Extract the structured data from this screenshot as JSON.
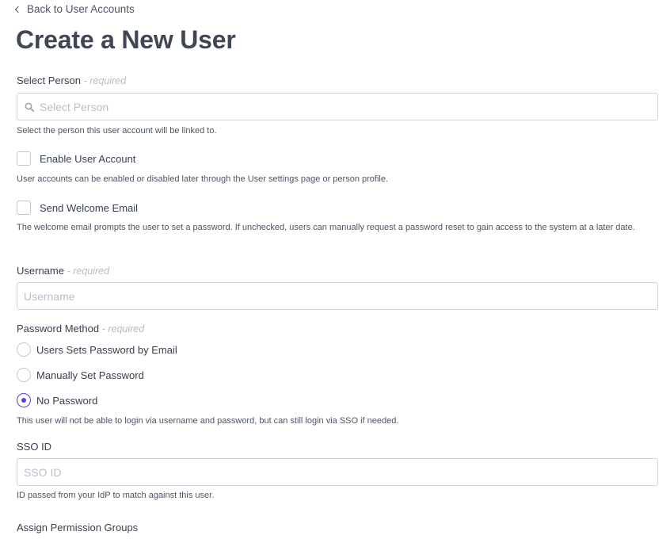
{
  "nav": {
    "back_label": "Back to User Accounts"
  },
  "page": {
    "title": "Create a New User"
  },
  "person": {
    "label": "Select Person",
    "required": "- required",
    "placeholder": "Select Person",
    "help": "Select the person this user account will be linked to."
  },
  "enable_account": {
    "label": "Enable User Account",
    "checked": false,
    "help": "User accounts can be enabled or disabled later through the User settings page or person profile."
  },
  "welcome_email": {
    "label": "Send Welcome Email",
    "checked": false,
    "help": "The welcome email prompts the user to set a password. If unchecked, users can manually request a password reset to gain access to the system at a later date."
  },
  "username": {
    "label": "Username",
    "required": "- required",
    "placeholder": "Username"
  },
  "password_method": {
    "label": "Password Method",
    "required": "- required",
    "options": [
      {
        "label": "Users Sets Password by Email",
        "selected": false
      },
      {
        "label": "Manually Set Password",
        "selected": false
      },
      {
        "label": "No Password",
        "selected": true
      }
    ],
    "help": "This user will not be able to login via username and password, but can still login via SSO if needed."
  },
  "sso": {
    "label": "SSO ID",
    "placeholder": "SSO ID",
    "help": "ID passed from your IdP to match against this user."
  },
  "permission_groups": {
    "label": "Assign Permission Groups"
  },
  "colors": {
    "accent": "#5146d8",
    "required_text": "#b6bcc6",
    "title": "#3f4654"
  },
  "icons": {
    "back": "chevron-left-icon",
    "search": "search-icon"
  }
}
